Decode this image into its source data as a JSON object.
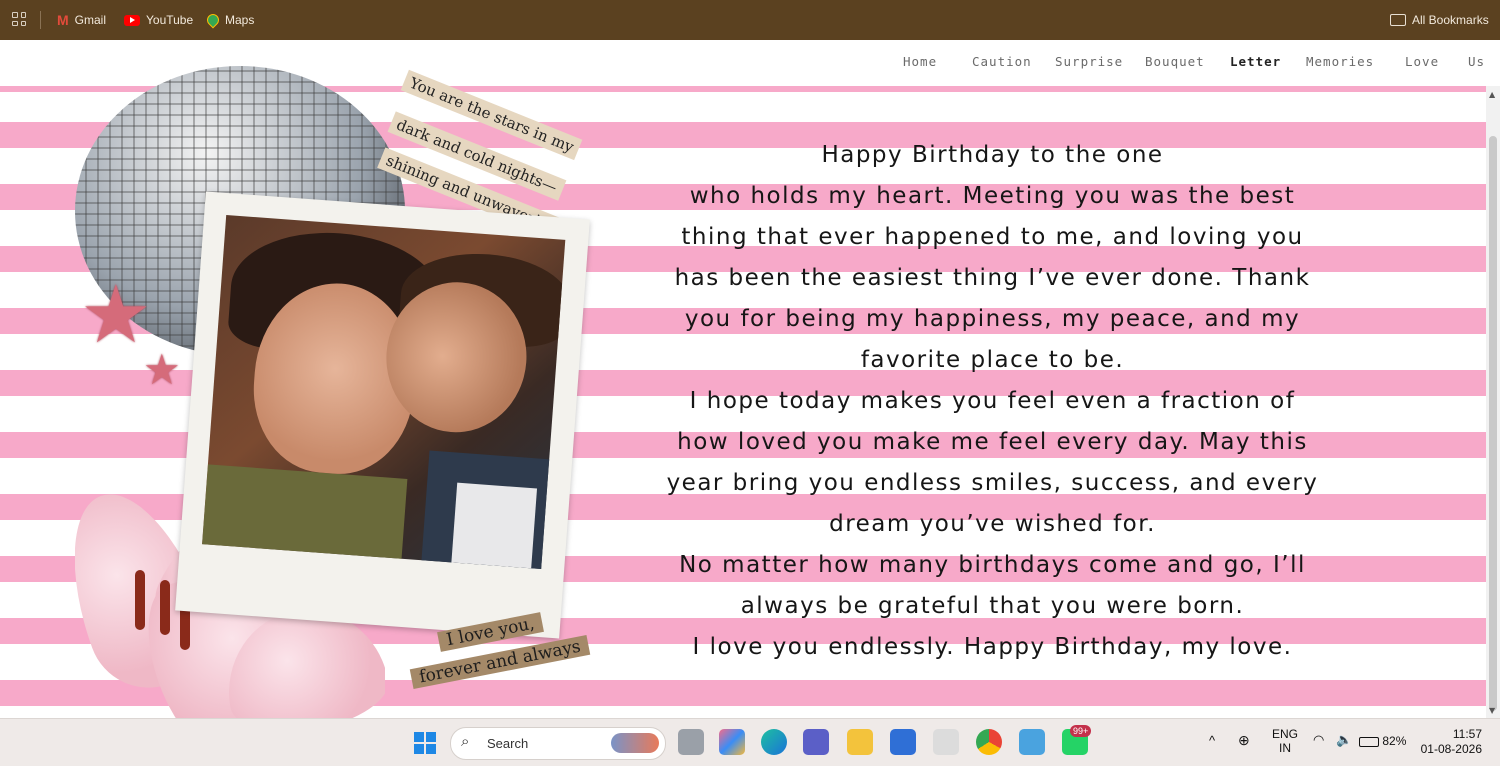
{
  "bookmarks": {
    "items": [
      {
        "label": "Gmail",
        "icon": "gmail-icon"
      },
      {
        "label": "YouTube",
        "icon": "youtube-icon"
      },
      {
        "label": "Maps",
        "icon": "maps-icon"
      }
    ],
    "all_bookmarks": "All Bookmarks"
  },
  "nav": {
    "items": [
      "Home",
      "Caution",
      "Surprise",
      "Bouquet",
      "Letter",
      "Memories",
      "Love",
      "Us"
    ],
    "active": "Letter"
  },
  "collage": {
    "note_lines": [
      "You are the stars in my",
      "dark and cold nights—",
      "shining and unwavering."
    ],
    "love_note_lines": [
      "I love you,",
      "forever and always"
    ]
  },
  "letter": {
    "lines": [
      "Happy Birthday to the one",
      "who holds my heart. Meeting you was the best",
      "thing that ever happened to me, and loving you",
      "has been the easiest thing I’ve ever done. Thank",
      "you for being my happiness, my peace, and my",
      "favorite place to be.",
      "I hope today makes you feel even a fraction of",
      "how loved you make me feel every day. May this",
      "year bring you endless smiles, success, and every",
      "dream you’ve wished for.",
      "No matter how many birthdays come and go, I’ll",
      "always be grateful that you were born.",
      "I love you endlessly. Happy Birthday, my love."
    ]
  },
  "taskbar": {
    "search_placeholder": "Search",
    "whatsapp_badge": "99+",
    "language": "ENG",
    "region": "IN",
    "battery": "82%",
    "time": "11:57",
    "date": "01-08-2026"
  },
  "colors": {
    "stripe_pink": "#f7a9c9",
    "bookmark_bar": "#5b4120"
  }
}
